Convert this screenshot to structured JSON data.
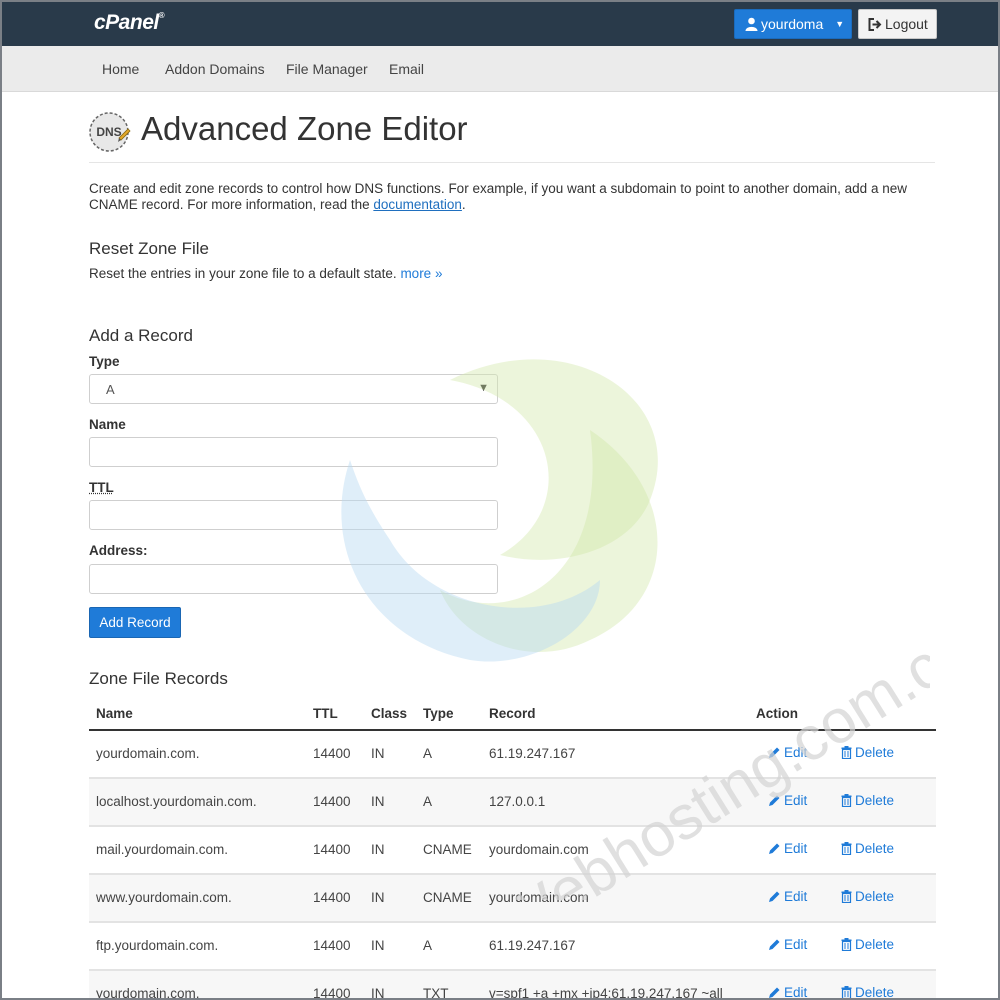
{
  "header": {
    "logo": "cPanel",
    "logo_mark": "®",
    "user_label": "yourdoma",
    "logout_label": "Logout"
  },
  "subnav": {
    "items": [
      {
        "label": "Home"
      },
      {
        "label": "Addon Domains"
      },
      {
        "label": "File Manager"
      },
      {
        "label": "Email"
      }
    ]
  },
  "page": {
    "icon_text": "DNS",
    "title": "Advanced Zone Editor",
    "intro_text": "Create and edit zone records to control how DNS functions. For example, if you want a subdomain to point to another domain, add a new CNAME record. For more information, read the ",
    "intro_link": "documentation",
    "intro_end": "."
  },
  "reset": {
    "heading": "Reset Zone File",
    "text": "Reset the entries in your zone file to a default state. ",
    "more_link": "more »"
  },
  "add_record": {
    "heading": "Add a Record",
    "type_label": "Type",
    "type_value": "A",
    "name_label": "Name",
    "name_value": "",
    "ttl_label": "TTL",
    "ttl_value": "",
    "address_label": "Address:",
    "address_value": "",
    "button_label": "Add Record"
  },
  "zone_records": {
    "heading": "Zone File Records",
    "columns": [
      "Name",
      "TTL",
      "Class",
      "Type",
      "Record",
      "Action"
    ],
    "edit_label": "Edit",
    "delete_label": "Delete",
    "rows": [
      {
        "name": "yourdomain.com.",
        "ttl": "14400",
        "class": "IN",
        "type": "A",
        "record": "61.19.247.167"
      },
      {
        "name": "localhost.yourdomain.com.",
        "ttl": "14400",
        "class": "IN",
        "type": "A",
        "record": "127.0.0.1"
      },
      {
        "name": "mail.yourdomain.com.",
        "ttl": "14400",
        "class": "IN",
        "type": "CNAME",
        "record": "yourdomain.com"
      },
      {
        "name": "www.yourdomain.com.",
        "ttl": "14400",
        "class": "IN",
        "type": "CNAME",
        "record": "yourdomain.com"
      },
      {
        "name": "ftp.yourdomain.com.",
        "ttl": "14400",
        "class": "IN",
        "type": "A",
        "record": "61.19.247.167"
      },
      {
        "name": "yourdomain.com.",
        "ttl": "14400",
        "class": "IN",
        "type": "TXT",
        "record": "v=spf1 +a +mx +ip4:61.19.247.167 ~all"
      }
    ]
  },
  "watermark": {
    "text": "Webhosting.com.co.th"
  },
  "colors": {
    "topbar": "#293a4a",
    "primary": "#1f7bd8",
    "subnav": "#ebebeb"
  }
}
